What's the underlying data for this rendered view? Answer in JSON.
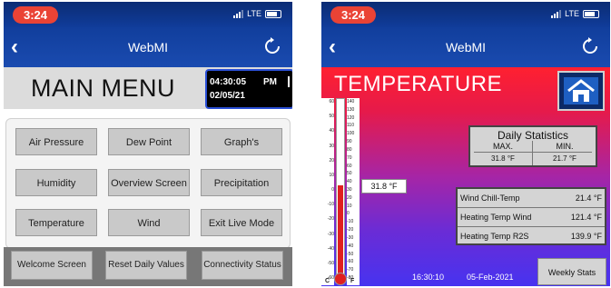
{
  "status_bar": {
    "time": "3:24",
    "network": "LTE"
  },
  "nav": {
    "back_icon": "chevron-left-icon",
    "title": "WebMI",
    "refresh_icon": "refresh-icon"
  },
  "main_menu": {
    "title": "MAIN MENU",
    "clock": {
      "time": "04:30:05",
      "ampm": "PM",
      "date": "02/05/21"
    },
    "buttons": [
      "Air Pressure",
      "Dew Point",
      "Graph's",
      "Humidity",
      "Overview Screen",
      "Precipitation",
      "Temperature",
      "Wind",
      "Exit Live Mode"
    ],
    "footer": [
      "Welcome Screen",
      "Reset Daily Values",
      "Connectivity Status"
    ]
  },
  "temperature": {
    "title": "TEMPERATURE",
    "home_icon": "home-icon",
    "current_value": "31.8 °F",
    "current_f": 31.8,
    "scale": {
      "celsius_ticks": [
        "60",
        "50",
        "40",
        "30",
        "20",
        "10",
        "0",
        "-10",
        "-20",
        "-30",
        "-40",
        "-50",
        "-60"
      ],
      "fahrenheit_ticks": [
        "140",
        "130",
        "120",
        "110",
        "100",
        "90",
        "80",
        "70",
        "60",
        "50",
        "40",
        "30",
        "20",
        "10",
        "0",
        "-10",
        "-20",
        "-30",
        "-40",
        "-50",
        "-60",
        "-70",
        "-80"
      ],
      "unit_c": "C",
      "unit_f": "F",
      "f_min": -80,
      "f_max": 140
    },
    "daily_stats": {
      "title": "Daily Statistics",
      "max_label": "MAX.",
      "min_label": "MIN.",
      "max_value": "31.8 °F",
      "min_value": "21.7 °F"
    },
    "calcs": [
      {
        "label": "Wind Chill-Temp",
        "value": "21.4 °F"
      },
      {
        "label": "Heating Temp Wind",
        "value": "121.4 °F"
      },
      {
        "label": "Heating Temp R2S",
        "value": "139.9 °F"
      }
    ],
    "footer_time": "16:30:10",
    "footer_date": "05-Feb-2021",
    "weekly_button": "Weekly Stats"
  },
  "colors": {
    "nav_blue": "#113e9c",
    "time_pill": "#ea4335",
    "gradient_top": "#ff2030",
    "gradient_bottom": "#4733f0"
  }
}
